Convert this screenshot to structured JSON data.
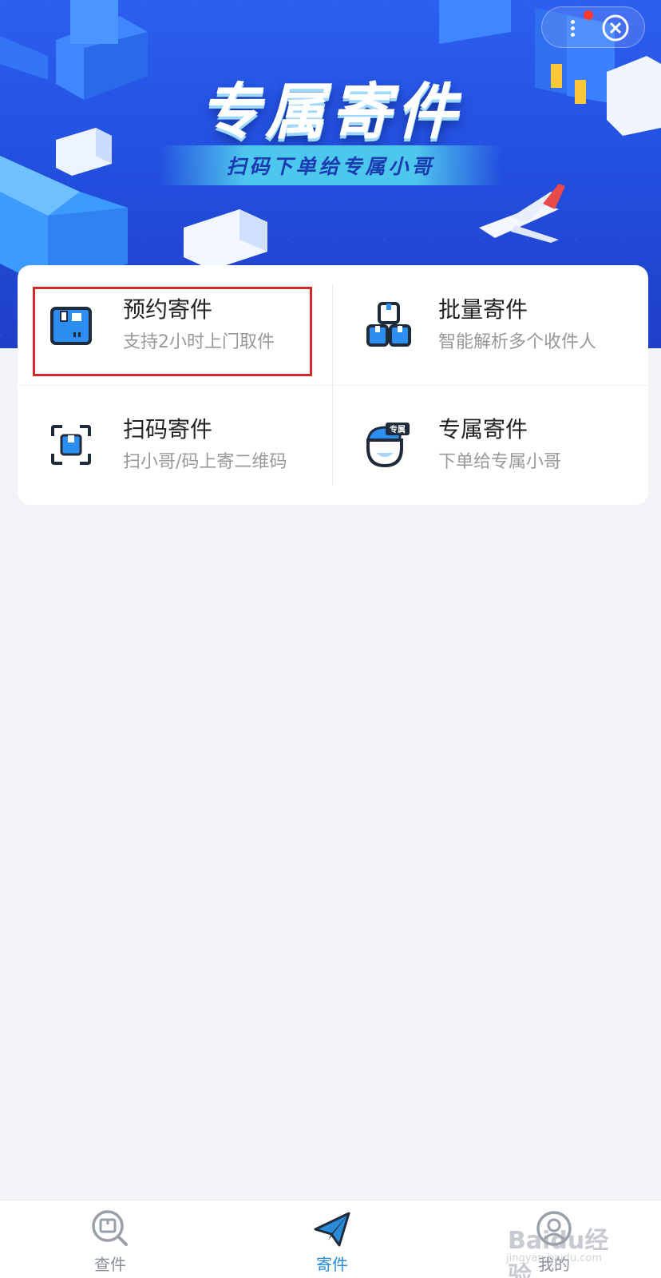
{
  "banner": {
    "title": "专属寄件",
    "subtitle": "扫码下单给专属小哥"
  },
  "menu": [
    {
      "title": "预约寄件",
      "subtitle": "支持2小时上门取件",
      "icon": "package-icon"
    },
    {
      "title": "批量寄件",
      "subtitle": "智能解析多个收件人",
      "icon": "stacked-boxes-icon"
    },
    {
      "title": "扫码寄件",
      "subtitle": "扫小哥/码上寄二维码",
      "icon": "scan-icon"
    },
    {
      "title": "专属寄件",
      "subtitle": "下单给专属小哥",
      "icon": "courier-icon"
    }
  ],
  "courier_badge": "专属",
  "tabs": [
    {
      "label": "查件",
      "icon": "search-package-icon",
      "active": false
    },
    {
      "label": "寄件",
      "icon": "paper-plane-icon",
      "active": true
    },
    {
      "label": "我的",
      "icon": "profile-icon",
      "active": false
    }
  ],
  "watermark": {
    "text": "Baidu经验",
    "sub": "jingyan.baidu.com"
  },
  "colors": {
    "banner": "#2350e0",
    "accent": "#2a8bd8",
    "icon_blue": "#2b8ef0",
    "highlight": "#d62a2a"
  }
}
